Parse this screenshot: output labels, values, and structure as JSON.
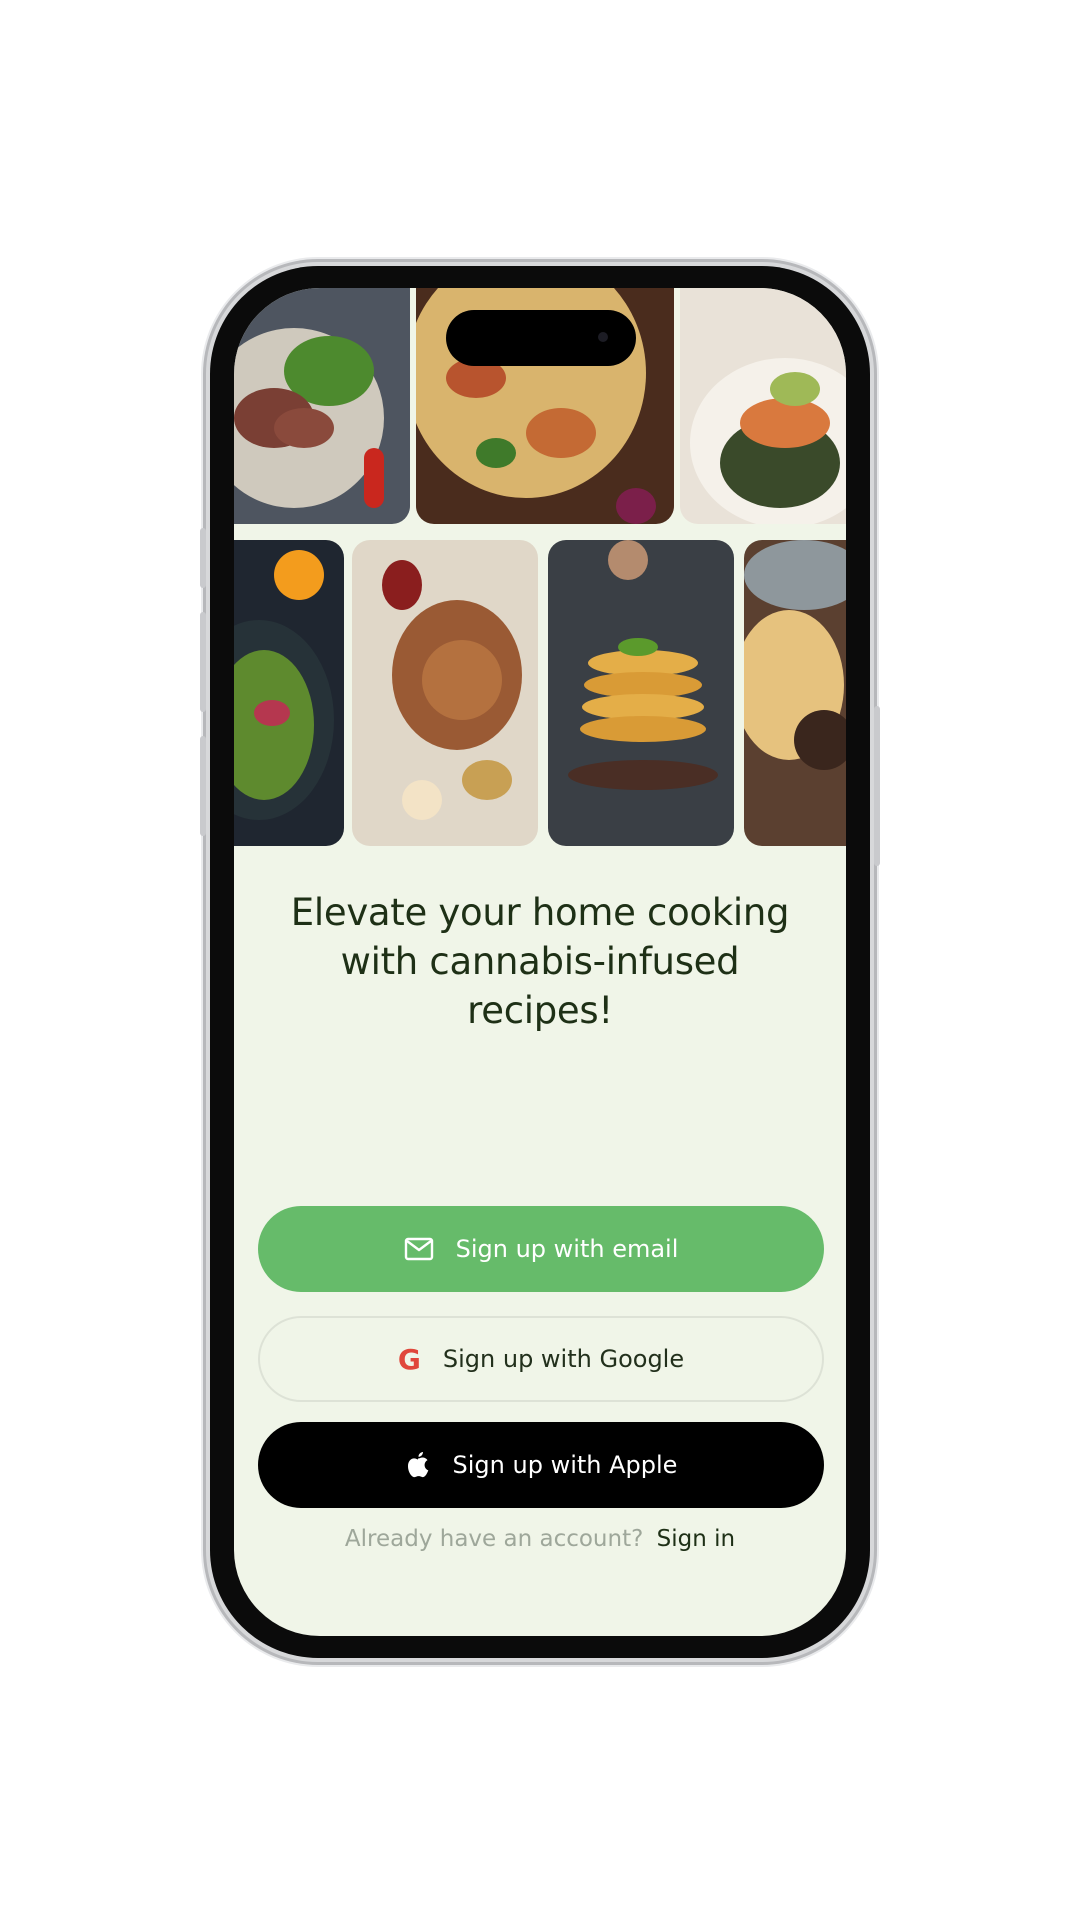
{
  "headline": "Elevate your home cooking with cannabis-infused recipes!",
  "buttons": {
    "email": {
      "label": "Sign up with email",
      "icon": "mail-icon"
    },
    "google": {
      "label": "Sign up with Google",
      "icon": "google-icon",
      "glyph": "G"
    },
    "apple": {
      "label": "Sign up with Apple",
      "icon": "apple-icon"
    }
  },
  "footer": {
    "prompt": "Already have an account?",
    "link": "Sign in"
  },
  "gallery": [
    "steak-salad-photo",
    "pizza-photo",
    "salmon-photo",
    "salad-photo",
    "grilled-skewers-photo",
    "pancakes-photo",
    "pastry-photo"
  ],
  "colors": {
    "background": "#f0f5e8",
    "email_button": "#66bb6a",
    "apple_button": "#000000",
    "heading_text": "#1e3016"
  }
}
